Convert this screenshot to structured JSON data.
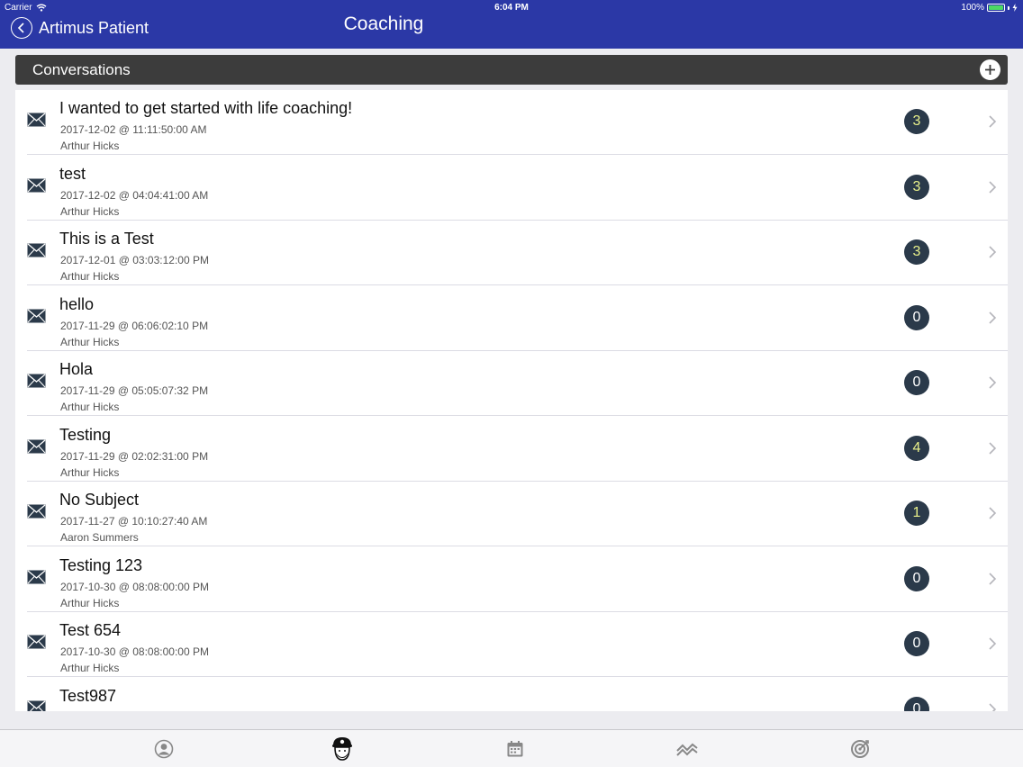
{
  "status_bar": {
    "carrier": "Carrier",
    "time": "6:04 PM",
    "battery": "100%"
  },
  "nav": {
    "back_label": "Artimus Patient",
    "title": "Coaching"
  },
  "section": {
    "title": "Conversations"
  },
  "conversations": [
    {
      "subject": "I wanted to get started with life coaching!",
      "date": "2017-12-02 @ 11:11:50:00 AM",
      "author": "Arthur Hicks",
      "count": "3"
    },
    {
      "subject": "test",
      "date": "2017-12-02 @ 04:04:41:00 AM",
      "author": "Arthur Hicks",
      "count": "3"
    },
    {
      "subject": "This is a Test",
      "date": "2017-12-01 @ 03:03:12:00 PM",
      "author": "Arthur Hicks",
      "count": "3"
    },
    {
      "subject": "hello",
      "date": "2017-11-29 @ 06:06:02:10 PM",
      "author": "Arthur Hicks",
      "count": "0"
    },
    {
      "subject": "Hola",
      "date": "2017-11-29 @ 05:05:07:32 PM",
      "author": "Arthur Hicks",
      "count": "0"
    },
    {
      "subject": "Testing",
      "date": "2017-11-29 @ 02:02:31:00 PM",
      "author": "Arthur Hicks",
      "count": "4"
    },
    {
      "subject": "No Subject",
      "date": "2017-11-27 @ 10:10:27:40 AM",
      "author": "Aaron Summers",
      "count": "1"
    },
    {
      "subject": "Testing 123",
      "date": "2017-10-30 @ 08:08:00:00 PM",
      "author": "Arthur Hicks",
      "count": "0"
    },
    {
      "subject": "Test 654",
      "date": "2017-10-30 @ 08:08:00:00 PM",
      "author": "Arthur Hicks",
      "count": "0"
    },
    {
      "subject": "Test987",
      "date": "",
      "author": "",
      "count": "0"
    }
  ],
  "tabs": [
    {
      "icon": "profile-icon"
    },
    {
      "icon": "coach-avatar-icon",
      "selected": true
    },
    {
      "icon": "calendar-icon"
    },
    {
      "icon": "trends-icon"
    },
    {
      "icon": "goals-target-icon"
    }
  ],
  "colors": {
    "nav_bg": "#2b38a6",
    "section_bg": "#3c3c3c",
    "badge_bg": "#2b3a4a",
    "badge_highlight_text": "#e8f08a",
    "battery": "#4cd964"
  }
}
